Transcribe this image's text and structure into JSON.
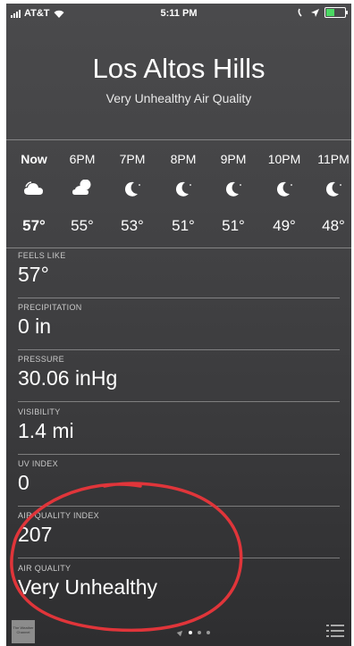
{
  "status_bar": {
    "carrier": "AT&T",
    "time": "5:11 PM",
    "battery_color": "#4cd964"
  },
  "header": {
    "city": "Los Altos Hills",
    "condition": "Very Unhealthy Air Quality"
  },
  "hourly": [
    {
      "time": "Now",
      "icon": "cloud-icon",
      "temp": "57°"
    },
    {
      "time": "6PM",
      "icon": "partly-cloudy-icon",
      "temp": "55°"
    },
    {
      "time": "7PM",
      "icon": "moon-icon",
      "temp": "53°"
    },
    {
      "time": "8PM",
      "icon": "moon-icon",
      "temp": "51°"
    },
    {
      "time": "9PM",
      "icon": "moon-icon",
      "temp": "51°"
    },
    {
      "time": "10PM",
      "icon": "moon-icon",
      "temp": "49°"
    },
    {
      "time": "11PM",
      "icon": "moon-icon",
      "temp": "48°"
    }
  ],
  "details": [
    {
      "label": "FEELS LIKE",
      "value": "57°"
    },
    {
      "label": "PRECIPITATION",
      "value": "0 in"
    },
    {
      "label": "PRESSURE",
      "value": "30.06 inHg"
    },
    {
      "label": "VISIBILITY",
      "value": "1.4 mi"
    },
    {
      "label": "UV INDEX",
      "value": "0"
    },
    {
      "label": "AIR QUALITY INDEX",
      "value": "207"
    },
    {
      "label": "AIR QUALITY",
      "value": "Very Unhealthy"
    }
  ],
  "toolbar": {
    "logo_text": "The Weather Channel",
    "page_count": 4,
    "active_page": 1
  },
  "annotation": {
    "color": "#e0353a"
  }
}
